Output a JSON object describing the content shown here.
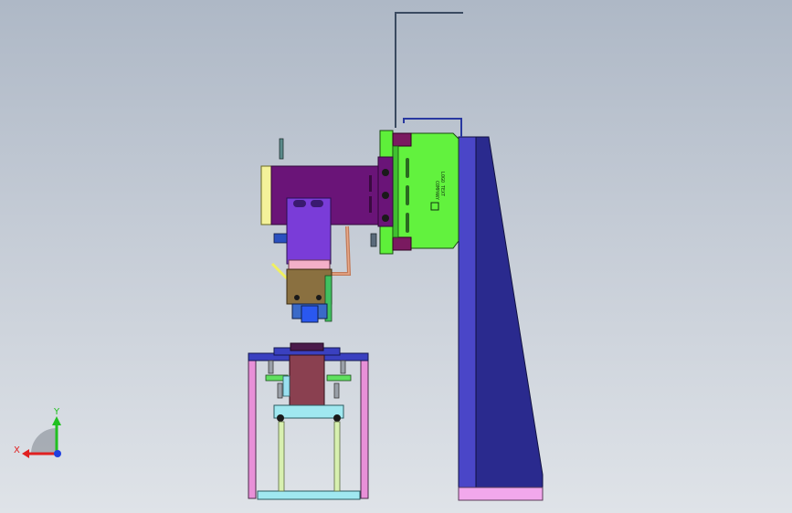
{
  "viewport": {
    "background_top": "#aeb8c6",
    "background_bottom": "#dfe3e8"
  },
  "triad": {
    "x_label": "X",
    "y_label": "Y",
    "x_color": "#e02020",
    "y_color": "#20c020",
    "z_color": "#2040e0"
  },
  "nameplate": {
    "lines": [
      "LOGO TEXT",
      "COMPANY"
    ]
  },
  "colors": {
    "column": "#3a3ab0",
    "column_edge": "#1c1c6e",
    "column_base": "#f0a8e8",
    "green_plate": "#5ef03a",
    "purple_arm": "#6a1478",
    "violet_block": "#7a3cd8",
    "head_brown": "#8a7040",
    "frame_pink": "#e890d8",
    "fixture_maroon": "#8a4050",
    "rail_blue": "#3a40c0",
    "cyan_plate": "#a0e8f0",
    "guide_rod": "#d8f0b0"
  }
}
